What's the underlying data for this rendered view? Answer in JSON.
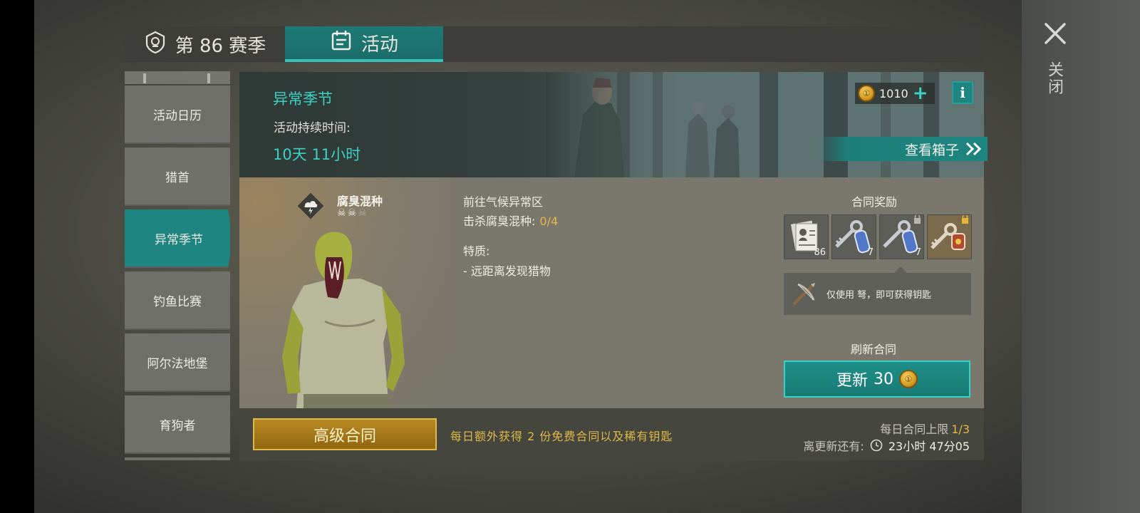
{
  "close": {
    "label": "关闭"
  },
  "tabs": [
    {
      "label": "第 86 赛季"
    },
    {
      "label": "活动"
    }
  ],
  "sidebar": {
    "items": [
      {
        "label": "活动日历"
      },
      {
        "label": "猎首"
      },
      {
        "label": "异常季节"
      },
      {
        "label": "钓鱼比赛"
      },
      {
        "label": "阿尔法地堡"
      },
      {
        "label": "育狗者"
      }
    ],
    "active_index": 2
  },
  "event": {
    "title": "异常季节",
    "duration_label": "活动持续时间:",
    "duration_value": "10天 11小时"
  },
  "currency": {
    "amount": "1010"
  },
  "view_box": {
    "label": "查看箱子"
  },
  "enemy": {
    "name": "腐臭混种",
    "difficulty": 2,
    "difficulty_max": 3,
    "icon": "storm-lightning-icon"
  },
  "task": {
    "goal": "前往气候异常区",
    "kill_label": "击杀腐臭混种:",
    "kill_progress": "0/4",
    "traits_label": "特质:",
    "traits": [
      "远距离发现猎物"
    ]
  },
  "rewards": {
    "title": "合同奖励",
    "items": [
      {
        "icon": "dossier-icon",
        "count": "86"
      },
      {
        "icon": "blue-key-icon",
        "count": "7"
      },
      {
        "icon": "blue-key-locked-icon",
        "count": "7"
      },
      {
        "icon": "red-key-locked-icon",
        "count": ""
      }
    ],
    "note": "仅使用 弩，即可获得钥匙",
    "note_icon": "crossbow-icon"
  },
  "refresh": {
    "title": "刷新合同",
    "button_label": "更新",
    "cost": "30"
  },
  "footer": {
    "premium_label": "高级合同",
    "premium_desc": "每日额外获得 2 份免费合同以及稀有钥匙",
    "daily_limit_label": "每日合同上限",
    "daily_limit_value": "1/3",
    "next_refresh_label": "离更新还有:",
    "next_refresh_time": "23小时 47分05"
  },
  "colors": {
    "accent_teal": "#1e8580",
    "highlight_teal": "#3dd0c4",
    "gold": "#e0b748"
  }
}
